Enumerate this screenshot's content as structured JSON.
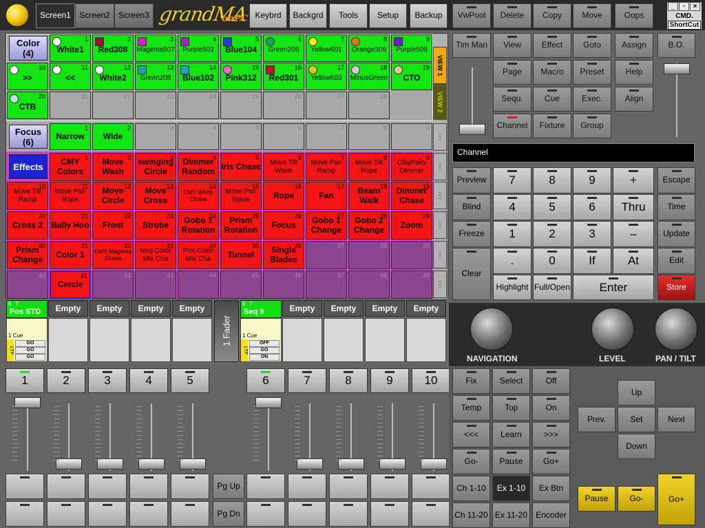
{
  "app": {
    "logo": "grandMA",
    "logo_suffix": "onPC"
  },
  "screens": [
    "Screen1",
    "Screen2",
    "Screen3"
  ],
  "toolbar": [
    "Keybrd",
    "Backgrd",
    "Tools",
    "Setup",
    "Backup"
  ],
  "window_controls": {
    "min": "_",
    "restore": "▫",
    "close": "×",
    "cmd": "CMD.",
    "shortcut": "ShortCut"
  },
  "command": [
    "VwPool",
    "Delete",
    "Copy",
    "Move",
    "Oops",
    "Tim Man",
    "View",
    "Effect",
    "Goto",
    "Assign",
    "B.O.",
    "Page",
    "Macro",
    "Preset",
    "Help",
    "Sequ.",
    "Cue",
    "Exec.",
    "Align",
    "Channel",
    "Fixture",
    "Group"
  ],
  "views": [
    "VIEW 1",
    "VIEW 2"
  ],
  "color": {
    "label": "Color",
    "count": "(4)",
    "items": [
      {
        "n": "1",
        "t": "White1",
        "c": "#ffffff",
        "s": "c"
      },
      {
        "n": "2",
        "t": "Red308",
        "c": "#9c1030",
        "s": "q"
      },
      {
        "n": "3",
        "t": "Magenta507",
        "c": "#d020c0",
        "s": "q",
        "sm": 1
      },
      {
        "n": "4",
        "t": "Purple502",
        "c": "#9030b0",
        "s": "q",
        "sm": 1
      },
      {
        "n": "5",
        "t": "Blue104",
        "c": "#2040d0",
        "s": "q"
      },
      {
        "n": "6",
        "t": "Green206",
        "c": "#20a060",
        "s": "c",
        "sm": 1
      },
      {
        "n": "7",
        "t": "Yellow601",
        "c": "#f0f010",
        "s": "c",
        "sm": 1
      },
      {
        "n": "8",
        "t": "Orange306",
        "c": "#f07010",
        "s": "c",
        "sm": 1
      },
      {
        "n": "9",
        "t": "Purple509",
        "c": "#7020c0",
        "s": "q",
        "sm": 1
      },
      {
        "n": "10",
        "t": ">>",
        "c": "#ffffff",
        "s": "c"
      },
      {
        "n": "11",
        "t": "<<",
        "c": "#ffffff",
        "s": "c"
      },
      {
        "n": "12",
        "t": "White2",
        "c": "#ffffff",
        "s": "c"
      },
      {
        "n": "13",
        "t": "Green208",
        "c": "#20a0a0",
        "s": "q",
        "sm": 1
      },
      {
        "n": "14",
        "t": "Blue102",
        "c": "#20a0c0",
        "s": "q"
      },
      {
        "n": "15",
        "t": "Pink312",
        "c": "#f060d0",
        "s": "c"
      },
      {
        "n": "16",
        "t": "Red301",
        "c": "#c01030",
        "s": "q"
      },
      {
        "n": "17",
        "t": "Yellow603",
        "c": "#f0c020",
        "s": "c",
        "sm": 1
      },
      {
        "n": "18",
        "t": "MinusGreen",
        "c": "#e0c0e0",
        "s": "c",
        "sm": 1
      },
      {
        "n": "19",
        "t": "CTO",
        "c": "#f0c090",
        "s": "c"
      },
      {
        "n": "20",
        "t": "CTB",
        "c": "#c0e0f0",
        "s": "c"
      },
      {
        "n": "21"
      },
      {
        "n": "22"
      },
      {
        "n": "23"
      },
      {
        "n": "24"
      },
      {
        "n": "25"
      },
      {
        "n": "26"
      },
      {
        "n": "27"
      },
      {
        "n": "28"
      }
    ]
  },
  "focus": {
    "label": "Focus",
    "count": "(6)",
    "items": [
      {
        "n": "1",
        "t": "Narrow"
      },
      {
        "n": "2",
        "t": "Wide"
      },
      {
        "n": "3"
      },
      {
        "n": "4"
      },
      {
        "n": "5"
      },
      {
        "n": "6"
      },
      {
        "n": "7"
      },
      {
        "n": "8"
      },
      {
        "n": "9"
      }
    ]
  },
  "effects": {
    "label": "Effects",
    "items": [
      {
        "n": "1",
        "t": "CMY Colors"
      },
      {
        "n": "2",
        "t": "Move Wash"
      },
      {
        "n": "3",
        "t": "swinging Circle"
      },
      {
        "n": "4",
        "t": "Dimmer Random"
      },
      {
        "n": "5",
        "t": "Iris Chase"
      },
      {
        "n": "6",
        "t": "Move Tilt Wave",
        "sm": 1
      },
      {
        "n": "7",
        "t": "Move Pan Ramp",
        "sm": 1
      },
      {
        "n": "8",
        "t": "Move Tilt Rope",
        "sm": 1
      },
      {
        "n": "9",
        "t": "ClayPaky Dimmer",
        "sm": 1
      },
      {
        "n": "10",
        "t": "Move Tilt Ramp",
        "sm": 1
      },
      {
        "n": "11",
        "t": "Move Pan Rope",
        "sm": 1
      },
      {
        "n": "12",
        "t": "Move Circle"
      },
      {
        "n": "13",
        "t": "Move Cross"
      },
      {
        "n": "14",
        "t": "CMY White Chase",
        "xs": 1
      },
      {
        "n": "15",
        "t": "Move Pan Wave",
        "sm": 1
      },
      {
        "n": "16",
        "t": "Rope"
      },
      {
        "n": "17",
        "t": "Fan"
      },
      {
        "n": "18",
        "t": "Beam Walk"
      },
      {
        "n": "19",
        "t": "Dimmer Chase"
      },
      {
        "n": "20",
        "t": "Cross 2"
      },
      {
        "n": "21",
        "t": "Bally Hoo"
      },
      {
        "n": "22",
        "t": "Frost"
      },
      {
        "n": "23",
        "t": "Strobe"
      },
      {
        "n": "24",
        "t": "Gobo 1 Rotation"
      },
      {
        "n": "25",
        "t": "Prism Rotation"
      },
      {
        "n": "26",
        "t": "Focus"
      },
      {
        "n": "27",
        "t": "Gobo 1 Change"
      },
      {
        "n": "28",
        "t": "Gobo 2 Change"
      },
      {
        "n": "29",
        "t": "Zoom"
      },
      {
        "n": "30",
        "t": "Prism Change"
      },
      {
        "n": "31",
        "t": "Color 1"
      },
      {
        "n": "32",
        "t": "CMY Magenta Chase",
        "xs": 1
      },
      {
        "n": "33",
        "t": "Neg Color Mix Cha",
        "sm": 1
      },
      {
        "n": "34",
        "t": "Pos Color Mix Cha",
        "sm": 1
      },
      {
        "n": "35",
        "t": "Tunnel"
      },
      {
        "n": "36",
        "t": "Single Blades"
      },
      {
        "n": "37"
      },
      {
        "n": "38"
      },
      {
        "n": "39"
      },
      {
        "n": "40"
      },
      {
        "n": "41",
        "t": "Cercle"
      },
      {
        "n": "42"
      },
      {
        "n": "43"
      },
      {
        "n": "44"
      },
      {
        "n": "45"
      },
      {
        "n": "46"
      },
      {
        "n": "47"
      },
      {
        "n": "48"
      },
      {
        "n": "49"
      }
    ]
  },
  "executors_left": {
    "num": "8",
    "t_flag": "T",
    "name": "Pos STD",
    "cue": "1 Cue",
    "ltp": "LTP",
    "go": [
      "GO",
      "GO",
      "GO"
    ]
  },
  "executors_right": {
    "num": "9",
    "t_flag": "T",
    "name": "Seq 9",
    "cue": "1 Cue",
    "ltp": "LTP",
    "go": [
      "OFF",
      "GO",
      "ON"
    ]
  },
  "empty_label": "Empty",
  "fader_label": "1 Fader",
  "commandline": "Channel",
  "keypad": {
    "preview": "Preview",
    "blind": "Blind",
    "freeze": "Freeze",
    "clear": "Clear",
    "highlight": "Highlight",
    "fullopen": "Full/Open",
    "enter": "Enter",
    "plus": "+",
    "thru": "Thru",
    "minus": "–",
    "if": "If",
    "at": "At",
    "dot": ".",
    "escape": "Escape",
    "time": "Time",
    "update": "Update",
    "edit": "Edit",
    "store": "Store",
    "digits": [
      "7",
      "8",
      "9",
      "4",
      "5",
      "6",
      "1",
      "2",
      "3",
      "0"
    ]
  },
  "encoders": {
    "navigation": "NAVIGATION",
    "level": "LEVEL",
    "pantilt": "PAN / TILT"
  },
  "faders": [
    "1",
    "2",
    "3",
    "4",
    "5",
    "6",
    "7",
    "8",
    "9",
    "10"
  ],
  "pg": [
    "Pg Up",
    "Pg Dn"
  ],
  "bottom_right": [
    "Fix",
    "Select",
    "Off",
    "Temp",
    "Top",
    "On",
    "<<<",
    "Learn",
    ">>>",
    "Go-",
    "Pause",
    "Go+",
    "Ch 1-10",
    "Ex 1-10",
    "Ex Btn",
    "Ch 11-20",
    "Ex 11-20",
    "Encoder"
  ],
  "nav": [
    "Up",
    "Prev.",
    "Set",
    "Next",
    "Down"
  ],
  "master": [
    "Pause",
    "Go-",
    "Go+"
  ]
}
